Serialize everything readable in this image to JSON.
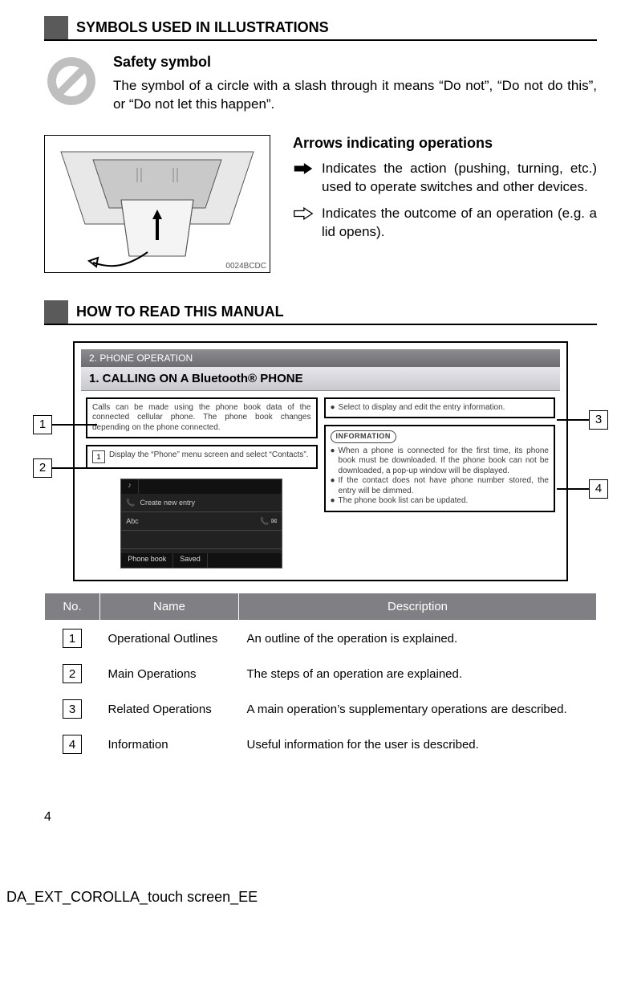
{
  "sections": {
    "symbols_title": "SYMBOLS USED IN ILLUSTRATIONS",
    "howto_title": "HOW TO READ THIS MANUAL"
  },
  "safety": {
    "heading": "Safety symbol",
    "body": "The symbol of a circle with a slash through it means “Do not”, “Do not do this”, or “Do not let this happen”."
  },
  "console_caption": "0024BCDC",
  "arrows": {
    "heading": "Arrows indicating operations",
    "item1": "Indicates the action (pushing, turning, etc.) used to operate switches and other devices.",
    "item2": "Indicates the outcome of an operation (e.g. a lid opens)."
  },
  "example_page": {
    "breadcrumb": "2. PHONE OPERATION",
    "title": "1. CALLING ON A Bluetooth® PHONE",
    "para1": "Calls can be made using the phone book data of the connected cellular phone. The phone book changes depending on the phone connected.",
    "step_num": "1",
    "step_text": "Display the “Phone” menu screen and select “Contacts”.",
    "bullet_select": "Select            to display and edit the entry information.",
    "info_label": "INFORMATION",
    "info_b1": "When a phone is connected for the first time, its phone book must be downloaded. If the phone book can not be downloaded, a pop-up window will be displayed.",
    "info_b2": "If the contact does not have phone number stored, the entry will be dimmed.",
    "info_b3": "The phone book list can be updated.",
    "screen": {
      "tab1": "♪",
      "row1": "Create new entry",
      "row2": "Abc",
      "btn1": "Phone book",
      "btn2": "Saved"
    }
  },
  "callouts": {
    "n1": "1",
    "n2": "2",
    "n3": "3",
    "n4": "4"
  },
  "table": {
    "h_no": "No.",
    "h_name": "Name",
    "h_desc": "Description",
    "rows": [
      {
        "num": "1",
        "name": "Operational Outlines",
        "desc": "An outline of the operation is explained."
      },
      {
        "num": "2",
        "name": "Main Operations",
        "desc": "The steps of an operation are explained."
      },
      {
        "num": "3",
        "name": "Related Operations",
        "desc": "A main operation’s supplementary operations are described."
      },
      {
        "num": "4",
        "name": "Information",
        "desc": "Useful information for the user is described."
      }
    ]
  },
  "page_number": "4",
  "footer": "DA_EXT_COROLLA_touch screen_EE"
}
